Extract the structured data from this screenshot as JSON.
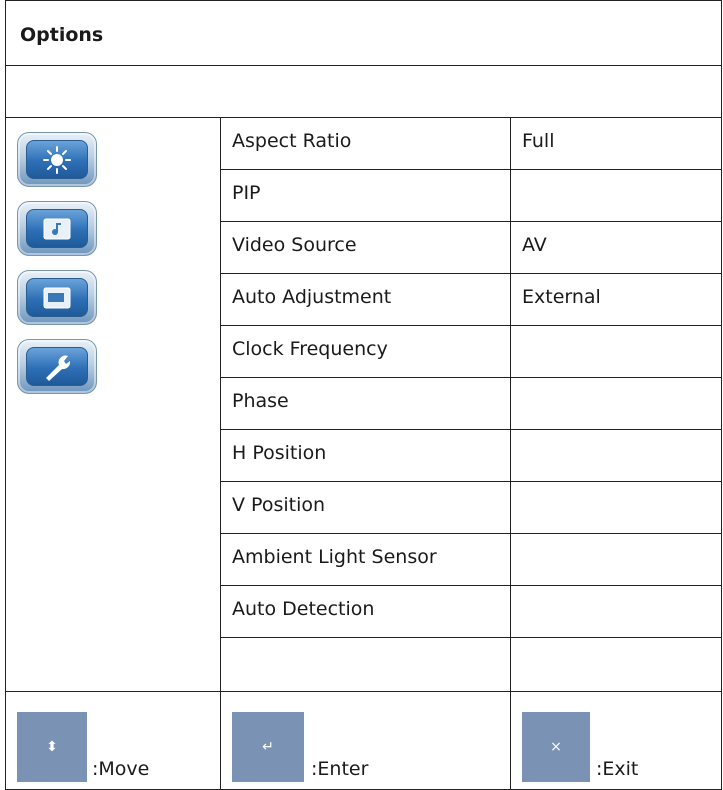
{
  "header": {
    "title": "Options"
  },
  "side_icons": [
    {
      "name": "brightness-icon"
    },
    {
      "name": "audio-icon"
    },
    {
      "name": "display-icon"
    },
    {
      "name": "wrench-icon"
    }
  ],
  "rows": [
    {
      "label": "Aspect Ratio",
      "value": "Full"
    },
    {
      "label": "PIP",
      "value": ""
    },
    {
      "label": "Video Source",
      "value": "AV"
    },
    {
      "label": "Auto Adjustment",
      "value": "External"
    },
    {
      "label": "Clock Frequency",
      "value": ""
    },
    {
      "label": "Phase",
      "value": ""
    },
    {
      "label": "H Position",
      "value": ""
    },
    {
      "label": "V Position",
      "value": ""
    },
    {
      "label": "Ambient Light Sensor",
      "value": ""
    },
    {
      "label": "Auto Detection",
      "value": ""
    },
    {
      "label": "",
      "value": ""
    }
  ],
  "footer": {
    "move": {
      "icon": "up-down-arrow-icon",
      "glyph": "⬍",
      "label": ":Move"
    },
    "enter": {
      "icon": "enter-icon",
      "glyph": "↵",
      "label": ":Enter"
    },
    "exit": {
      "icon": "close-icon",
      "glyph": "×",
      "label": ":Exit"
    }
  },
  "colors": {
    "key_box": "#7a93b4",
    "icon_blue": "#2d6fb6"
  }
}
